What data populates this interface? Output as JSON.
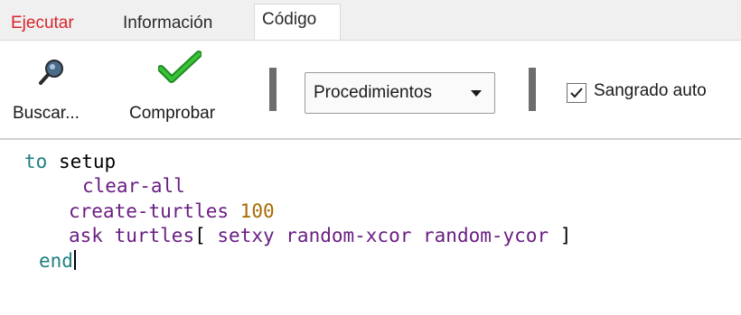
{
  "tabs": [
    {
      "label": "Ejecutar"
    },
    {
      "label": "Información"
    },
    {
      "label": "Código"
    }
  ],
  "toolbar": {
    "find_label": "Buscar...",
    "check_label": "Comprobar",
    "procedures_label": "Procedimientos",
    "auto_indent_label": "Sangrado auto",
    "auto_indent_checked": true
  },
  "editor": {
    "lines": [
      {
        "kw1": "to",
        "rest1": " setup"
      },
      {
        "prim": "clear-all"
      },
      {
        "prim": "create-turtles",
        "num": "100"
      },
      {
        "prim1": "ask",
        "prim2": "turtles",
        "text1": "[ ",
        "prim3": "setxy",
        "prim4": "random-xcor",
        "prim5": "random-ycor",
        "text2": " ]"
      },
      {
        "kw": "end"
      }
    ]
  },
  "colors": {
    "keyword": "#1e7f7f",
    "primitive": "#6a1e82",
    "number": "#a86a00",
    "active_tab": "#d8242b"
  }
}
